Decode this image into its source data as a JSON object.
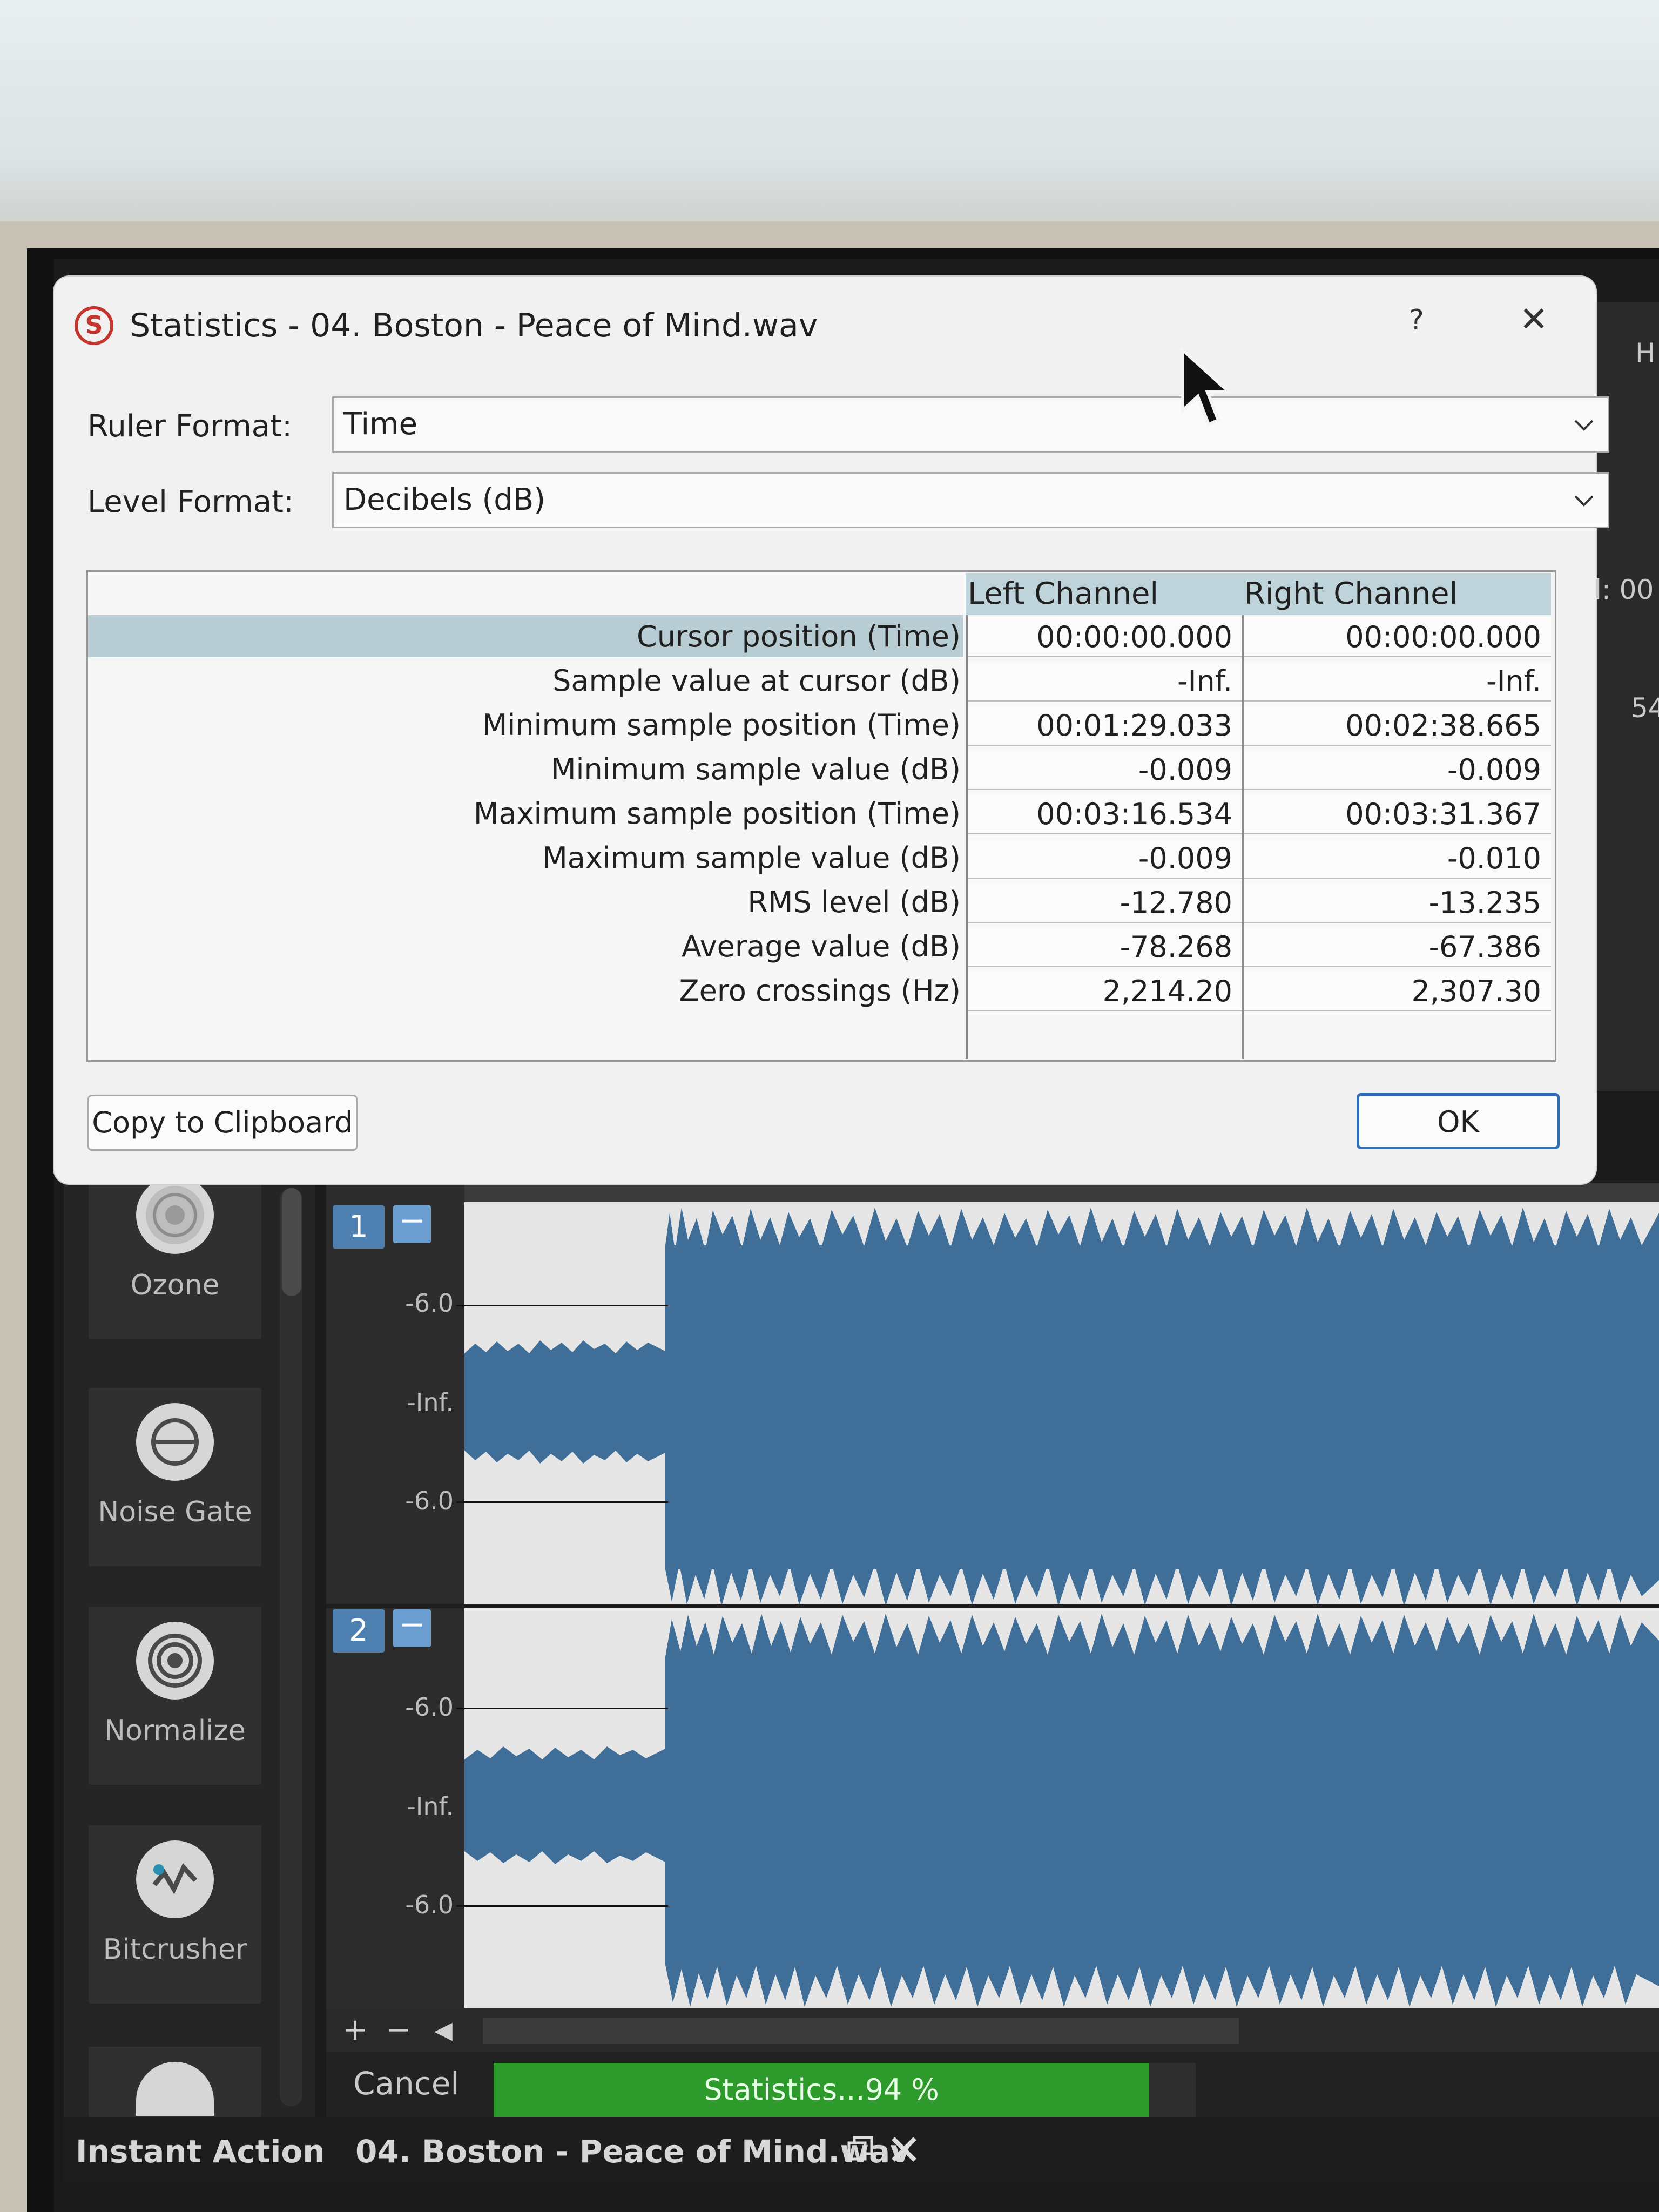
{
  "dialog": {
    "title": "Statistics - 04. Boston - Peace of Mind.wav",
    "logo_letter": "S",
    "help_label": "?",
    "close_label": "✕",
    "ruler_format_label": "Ruler Format:",
    "ruler_format_value": "Time",
    "level_format_label": "Level Format:",
    "level_format_value": "Decibels (dB)",
    "columns": [
      "Left Channel",
      "Right Channel"
    ],
    "rows": [
      {
        "label": "Cursor position (Time)",
        "left": "00:00:00.000",
        "right": "00:00:00.000"
      },
      {
        "label": "Sample value at cursor (dB)",
        "left": "-Inf.",
        "right": "-Inf."
      },
      {
        "label": "Minimum sample position (Time)",
        "left": "00:01:29.033",
        "right": "00:02:38.665"
      },
      {
        "label": "Minimum sample value (dB)",
        "left": "-0.009",
        "right": "-0.009"
      },
      {
        "label": "Maximum sample position (Time)",
        "left": "00:03:16.534",
        "right": "00:03:31.367"
      },
      {
        "label": "Maximum sample value (dB)",
        "left": "-0.009",
        "right": "-0.010"
      },
      {
        "label": "RMS level (dB)",
        "left": "-12.780",
        "right": "-13.235"
      },
      {
        "label": "Average value (dB)",
        "left": "-78.268",
        "right": "-67.386"
      },
      {
        "label": "Zero crossings (Hz)",
        "left": "2,214.20",
        "right": "2,307.30"
      }
    ],
    "copy_button": "Copy to Clipboard",
    "ok_button": "OK"
  },
  "background_app": {
    "right_edge_texts": [
      "H",
      "l: 00",
      "54"
    ]
  },
  "sidebar": {
    "plugins": [
      {
        "label": "Ozone",
        "icon": "ozone-icon"
      },
      {
        "label": "Noise Gate",
        "icon": "noise-gate-icon"
      },
      {
        "label": "Normalize",
        "icon": "normalize-icon"
      },
      {
        "label": "Bitcrusher",
        "icon": "bitcrusher-icon"
      }
    ]
  },
  "tracks": [
    {
      "number": "1",
      "minus": "−",
      "db_labels": [
        "-6.0",
        "-Inf.",
        "-6.0"
      ]
    },
    {
      "number": "2",
      "minus": "−",
      "db_labels": [
        "-6.0",
        "-Inf.",
        "-6.0"
      ]
    }
  ],
  "transport": {
    "plus": "+",
    "minus": "−",
    "left_arrow": "◀"
  },
  "status": {
    "cancel_label": "Cancel",
    "progress_text": "Statistics...94 %",
    "progress_percent": 94
  },
  "tabs": {
    "panel_tab": "Instant Action",
    "file_tab": "04. Boston - Peace of Mind.wav",
    "restore_icon": "restore-icon",
    "close_icon": "close-icon"
  },
  "colors": {
    "waveform": "#3f6f98",
    "progress_fill": "#2f9a2c",
    "selection_row": "#b8ccd3",
    "ok_border": "#2f6db5",
    "logo": "#c3352d"
  }
}
